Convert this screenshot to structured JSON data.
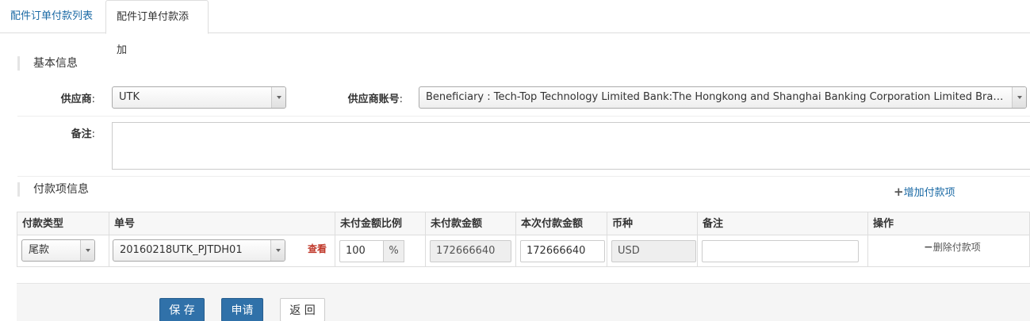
{
  "tabs": [
    {
      "label": "配件订单付款列表"
    },
    {
      "label": "配件订单付款添加"
    }
  ],
  "sections": {
    "basic": "基本信息",
    "payment_items": "付款项信息"
  },
  "form": {
    "supplier_label": "供应商",
    "supplier_value": "UTK",
    "account_label": "供应商账号",
    "account_value": "Beneficiary : Tech-Top Technology Limited Bank:The Hongkong and Shanghai Banking Corporation Limited Branch : Telfor...",
    "remark_label": "备注",
    "colon": ":"
  },
  "add_item_label": "增加付款项",
  "table": {
    "headers": [
      "付款类型",
      "单号",
      "未付金额比例",
      "未付款金额",
      "本次付款金额",
      "币种",
      "备注",
      "操作"
    ],
    "row": {
      "pay_type": "尾款",
      "order_no": "20160218UTK_PJTDH01",
      "view_label": "查看",
      "unpaid_ratio": "100",
      "percent": "%",
      "unpaid_amount": "172666640",
      "pay_amount": "172666640",
      "currency": "USD",
      "remark": "",
      "delete_label": "删除付款项"
    }
  },
  "buttons": {
    "save": "保 存",
    "apply": "申请",
    "back": "返 回"
  },
  "colors": {
    "primary": "#3071a9",
    "link": "#1b6aa5",
    "view_link": "#c0392b"
  }
}
